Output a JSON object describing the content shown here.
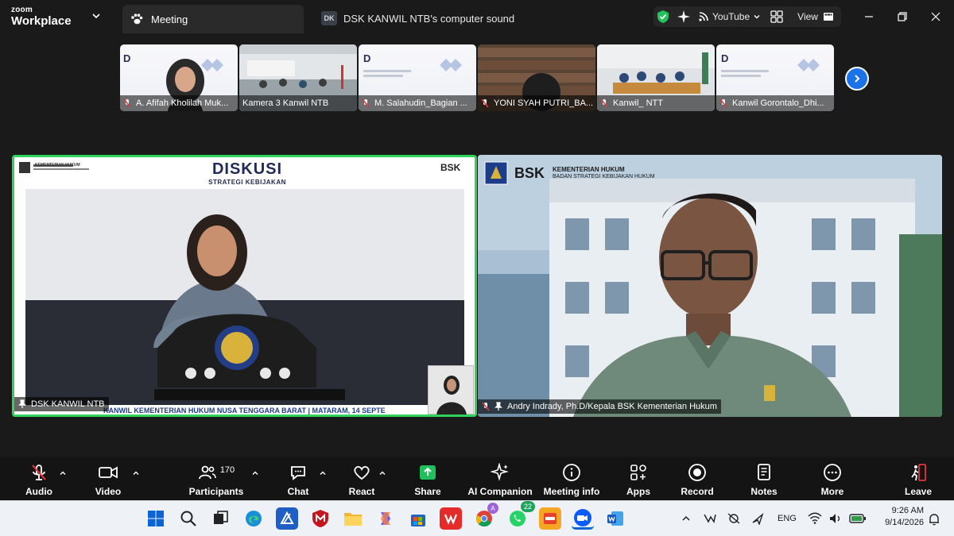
{
  "app": {
    "brand_top": "zoom",
    "brand_main": "Workplace"
  },
  "tabs": {
    "meeting": "Meeting",
    "sound_badge": "DK",
    "sound": "DSK KANWIL NTB's computer sound"
  },
  "titlebar": {
    "youtube": "YouTube",
    "view": "View"
  },
  "thumbnails": [
    {
      "label": "A. Afifah Kholilah Muk..."
    },
    {
      "label": "Kamera 3 Kanwil NTB"
    },
    {
      "label": "M. Salahudin_Bagian ..."
    },
    {
      "label": "YONI SYAH PUTRI_BA..."
    },
    {
      "label": "Kanwil_ NTT"
    },
    {
      "label": "Kanwil Gorontalo_Dhi..."
    }
  ],
  "main": {
    "left": {
      "name": "DSK KANWIL NTB",
      "ticker": "KANWIL KEMENTERIAN HUKUM NUSA TENGGARA BARAT | MATARAM, 14 SEPTE",
      "slide_title": "DISKUSI",
      "slide_subtitle": "STRATEGI KEBIJAKAN",
      "org_small": "KEMENTERIAN HUKUM",
      "bsk": "BSK"
    },
    "right": {
      "name": "Andry Indrady, Ph.D/Kepala BSK Kementerian Hukum",
      "org1": "KEMENTERIAN HUKUM",
      "org2": "BADAN STRATEGI KEBIJAKAN HUKUM",
      "bsk": "BSK"
    }
  },
  "toolbar": {
    "audio": "Audio",
    "video": "Video",
    "participants": "Participants",
    "participants_count": "170",
    "chat": "Chat",
    "react": "React",
    "share": "Share",
    "ai": "AI Companion",
    "info": "Meeting info",
    "apps": "Apps",
    "record": "Record",
    "notes": "Notes",
    "more": "More",
    "leave": "Leave"
  },
  "taskbar": {
    "whatsapp_badge": "22",
    "chrome_badge": "A",
    "lang": "ENG",
    "time": "9:26 AM",
    "date": "9/14/2026"
  },
  "colors": {
    "active_border": "#2fd35c",
    "next_button": "#1a73e8",
    "mic_muted": "#e0343c",
    "share": "#20c05c"
  }
}
